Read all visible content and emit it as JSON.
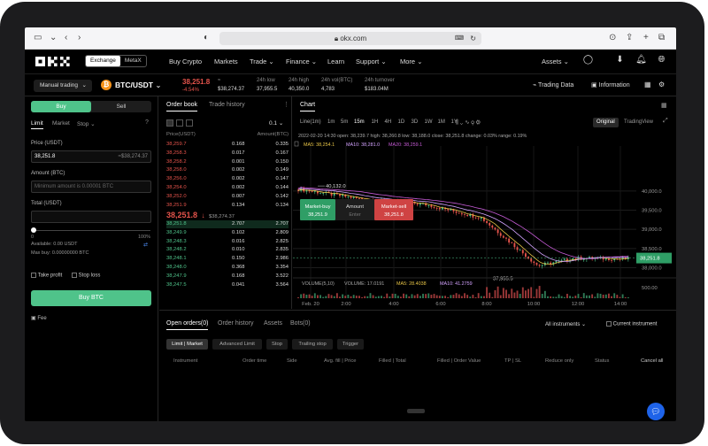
{
  "browser": {
    "url": "okx.com"
  },
  "nav": {
    "mode_options": [
      "Exchange",
      "MetaX"
    ],
    "items": [
      "Buy Crypto",
      "Markets",
      "Trade",
      "Finance",
      "Learn",
      "Support",
      "More"
    ],
    "assets": "Assets"
  },
  "ticker": {
    "mode": "Manual trading",
    "pair": "BTC/USDT",
    "price": "38,251.8",
    "change": "-4.54%",
    "usd_price": "$38,274.37",
    "stats": [
      {
        "label": "24h low",
        "value": "37,955.5"
      },
      {
        "label": "24h high",
        "value": "40,350.0"
      },
      {
        "label": "24h vol(BTC)",
        "value": "4,783"
      },
      {
        "label": "24h turnover",
        "value": "$183.04M"
      }
    ],
    "trading_data": "Trading Data",
    "information": "Information"
  },
  "form": {
    "buy": "Buy",
    "sell": "Sell",
    "order_types": [
      "Limit",
      "Market",
      "Stop"
    ],
    "price_label": "Price (USDT)",
    "price_value": "38,251.8",
    "price_conv": "≈$38,274.37",
    "amount_label": "Amount (BTC)",
    "amount_placeholder": "Minimum amount is 0.00001 BTC",
    "total_label": "Total (USDT)",
    "slider_min": "0",
    "slider_max": "100%",
    "available": "Available: 0.00 USDT",
    "max_buy": "Max buy: 0.00000000 BTC",
    "take_profit": "Take profit",
    "stop_loss": "Stop loss",
    "submit": "Buy BTC",
    "fee": "Fee"
  },
  "orderbook": {
    "tabs": [
      "Order book",
      "Trade history"
    ],
    "step": "0.1",
    "col_price": "Price(USDT)",
    "col_amount": "Amount(BTC)",
    "asks": [
      [
        "38,259.7",
        "0.168",
        "0.335"
      ],
      [
        "38,258.3",
        "0.017",
        "0.167"
      ],
      [
        "38,258.2",
        "0.001",
        "0.150"
      ],
      [
        "38,258.0",
        "0.002",
        "0.149"
      ],
      [
        "38,256.0",
        "0.002",
        "0.147"
      ],
      [
        "38,254.0",
        "0.002",
        "0.144"
      ],
      [
        "38,252.0",
        "0.007",
        "0.142"
      ],
      [
        "38,251.9",
        "0.134",
        "0.134"
      ]
    ],
    "mid_price": "38,251.8",
    "mid_usd": "$38,274.37",
    "bids": [
      [
        "38,251.8",
        "2.707",
        "2.707"
      ],
      [
        "38,249.9",
        "0.102",
        "2.809"
      ],
      [
        "38,248.3",
        "0.016",
        "2.825"
      ],
      [
        "38,248.2",
        "0.010",
        "2.835"
      ],
      [
        "38,248.1",
        "0.150",
        "2.986"
      ],
      [
        "38,248.0",
        "0.368",
        "3.354"
      ],
      [
        "38,247.9",
        "0.168",
        "3.522"
      ],
      [
        "38,247.5",
        "0.041",
        "3.564"
      ]
    ]
  },
  "chart": {
    "title": "Chart",
    "intervals": [
      "Line(1m)",
      "1m",
      "5m",
      "15m",
      "1H",
      "4H",
      "1D",
      "3D",
      "1W",
      "1M",
      "1Y"
    ],
    "view_original": "Original",
    "view_tv": "TradingView",
    "info_line": "2022-02-20 14:30   open: 38,239.7   high: 38,260.8   low: 38,188.0   close: 38,251.8   change: 0.03%   range: 0.19%",
    "ma_line": [
      "MA5: 38,254.1",
      "MA10: 38,281.0",
      "MA20: 38,259.1"
    ],
    "high_label": "40,132.0",
    "low_label": "37,955.5",
    "current_label": "38,251.8",
    "y_ticks": [
      "40,000.0",
      "39,500.0",
      "39,000.0",
      "38,500.0",
      "38,000.0"
    ],
    "vol_line": [
      "VOLUME(5,10)",
      "VOLUME: 17.0191",
      "MA5: 28.4038",
      "MA10: 41.2759"
    ],
    "vol_ticks": [
      "500.00"
    ],
    "x_ticks": [
      "Feb. 20",
      "2:00",
      "4:00",
      "6:00",
      "8:00",
      "10:00",
      "12:00",
      "14:00"
    ],
    "quick_trade": {
      "buy_label": "Market-buy",
      "buy_price": "38,251.9",
      "amount_label": "Amount",
      "amount_placeholder": "Enter",
      "sell_label": "Market-sell",
      "sell_price": "38,251.8"
    }
  },
  "orders": {
    "tabs": [
      "Open orders(0)",
      "Order history",
      "Assets",
      "Bots(0)"
    ],
    "filter": "All instruments",
    "current": "Current instrument",
    "subtabs": [
      "Limit | Market",
      "Advanced Limit",
      "Stop",
      "Trailing stop",
      "Trigger"
    ],
    "columns": [
      "Instrument",
      "Order time",
      "Side",
      "Avg. fill | Price",
      "Filled | Total",
      "Filled | Order Value",
      "TP | SL",
      "Reduce only",
      "Status",
      "Cancel all"
    ]
  }
}
